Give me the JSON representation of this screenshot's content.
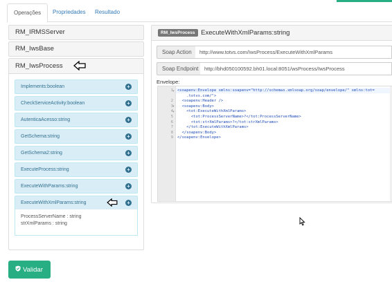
{
  "tabs": [
    {
      "label": "Operações",
      "active": true
    },
    {
      "label": "Propriedades",
      "active": false
    },
    {
      "label": "Resultado",
      "active": false
    }
  ],
  "services": [
    {
      "label": "RM_IRMSServer"
    },
    {
      "label": "RM_IwsBase"
    },
    {
      "label": "RM_IwsProcess"
    }
  ],
  "methods": [
    {
      "label": "Implements:boolean"
    },
    {
      "label": "CheckServiceActivity:boolean"
    },
    {
      "label": "AutenticaAcesso:string"
    },
    {
      "label": "GetSchema:string"
    },
    {
      "label": "GetSchema2:string"
    },
    {
      "label": "ExecuteProcess:string"
    },
    {
      "label": "ExecuteWithParams:string"
    },
    {
      "label": "ExecuteWithXmlParams:string"
    }
  ],
  "method_params": [
    "ProcessServerName : string",
    "strXmlParams : string"
  ],
  "operation": {
    "badge": "RM_IwsProcess",
    "title": "ExecuteWithXmlParams:string",
    "soap_action_label": "Soap Action",
    "soap_action_value": "http://www.totvs.com/IwsProcess/ExecuteWithXmlParams",
    "soap_endpoint_label": "Soap Endpoint",
    "soap_endpoint_value": "http://bhd050100592.bh01.local:8051/wsProcess/IwsProcess",
    "envelope_label": "Envelope:"
  },
  "envelope_lines": [
    {
      "n": "1",
      "fold": "▾",
      "text": "<soapenv:Envelope xmlns:soapenv=\"http://schemas.xmlsoap.org/soap/envelope/\" xmlns:tot="
    },
    {
      "n": "",
      "fold": "",
      "text": "    .totvs.com/\">"
    },
    {
      "n": "2",
      "fold": "",
      "text": "  <soapenv:Header />"
    },
    {
      "n": "3",
      "fold": "▾",
      "text": "  <soapenv:Body>"
    },
    {
      "n": "4",
      "fold": "▾",
      "text": "    <tot:ExecuteWithXmlParams>"
    },
    {
      "n": "5",
      "fold": "",
      "text": "      <tot:ProcessServerName>?</tot:ProcessServerName>"
    },
    {
      "n": "6",
      "fold": "",
      "text": "      <tot:strXmlParams>?</tot:strXmlParams>"
    },
    {
      "n": "7",
      "fold": "",
      "text": "    </tot:ExecuteWithXmlParams>"
    },
    {
      "n": "8",
      "fold": "",
      "text": "  </soapenv:Body>"
    },
    {
      "n": "9",
      "fold": "",
      "text": "</soapenv:Envelope>"
    }
  ],
  "validate_label": "Validar",
  "icons": {
    "validate": "check-shield-icon",
    "expand": "plus-circle-icon",
    "annotation": "left-arrow-icon"
  },
  "colors": {
    "accent": "#27ae82",
    "method_bg": "#d9edf7",
    "method_text": "#31708f"
  }
}
